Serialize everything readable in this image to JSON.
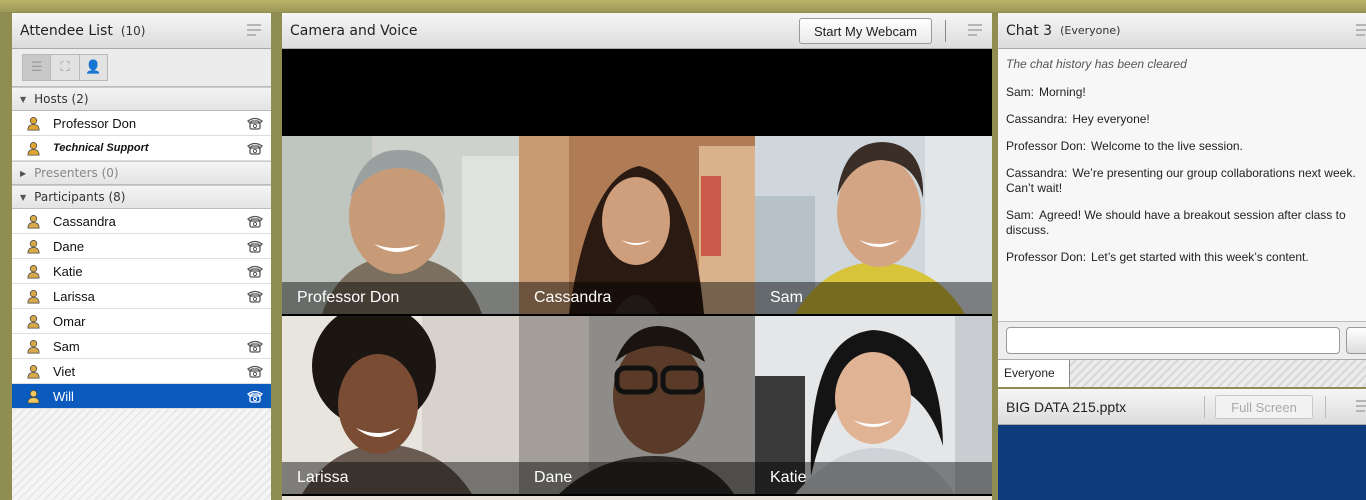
{
  "attendee_pod": {
    "title": "Attendee List",
    "count": "(10)",
    "sections": {
      "hosts": "Hosts (2)",
      "presenters": "Presenters (0)",
      "participants": "Participants (8)"
    },
    "hosts": [
      {
        "name": "Professor Don",
        "phone": true
      },
      {
        "name": "Technical Support",
        "phone": true
      }
    ],
    "participants": [
      {
        "name": "Cassandra",
        "phone": true
      },
      {
        "name": "Dane",
        "phone": true
      },
      {
        "name": "Katie",
        "phone": true
      },
      {
        "name": "Larissa",
        "phone": true
      },
      {
        "name": "Omar",
        "phone": false
      },
      {
        "name": "Sam",
        "phone": true
      },
      {
        "name": "Viet",
        "phone": true
      },
      {
        "name": "Will",
        "phone": true,
        "selected": true
      }
    ]
  },
  "camera_pod": {
    "title": "Camera and Voice",
    "webcam_button": "Start My Webcam",
    "tiles": [
      {
        "name": "Professor Don"
      },
      {
        "name": "Cassandra"
      },
      {
        "name": "Sam"
      },
      {
        "name": "Larissa"
      },
      {
        "name": "Dane"
      },
      {
        "name": "Katie"
      }
    ]
  },
  "chat_pod": {
    "title": "Chat 3",
    "scope": "(Everyone)",
    "cleared_notice": "The chat history has been cleared",
    "messages": [
      {
        "who": "Sam:",
        "text": "Morning!"
      },
      {
        "who": "Cassandra:",
        "text": "Hey everyone!"
      },
      {
        "who": "Professor Don:",
        "text": "Welcome to the live session."
      },
      {
        "who": "Cassandra:",
        "text": "We’re presenting our group collaborations next week. Can’t wait!"
      },
      {
        "who": "Sam:",
        "text": "Agreed! We should have a breakout session after class to discuss."
      },
      {
        "who": "Professor Don:",
        "text": "Let’s get started with this week’s content."
      }
    ],
    "tab": "Everyone"
  },
  "share_pod": {
    "title": "BIG DATA 215.pptx",
    "fullscreen_button": "Full Screen"
  },
  "colors": {
    "selection": "#0b5bbf",
    "frame": "#8f8d52",
    "share_bg": "#0e3c7d"
  }
}
